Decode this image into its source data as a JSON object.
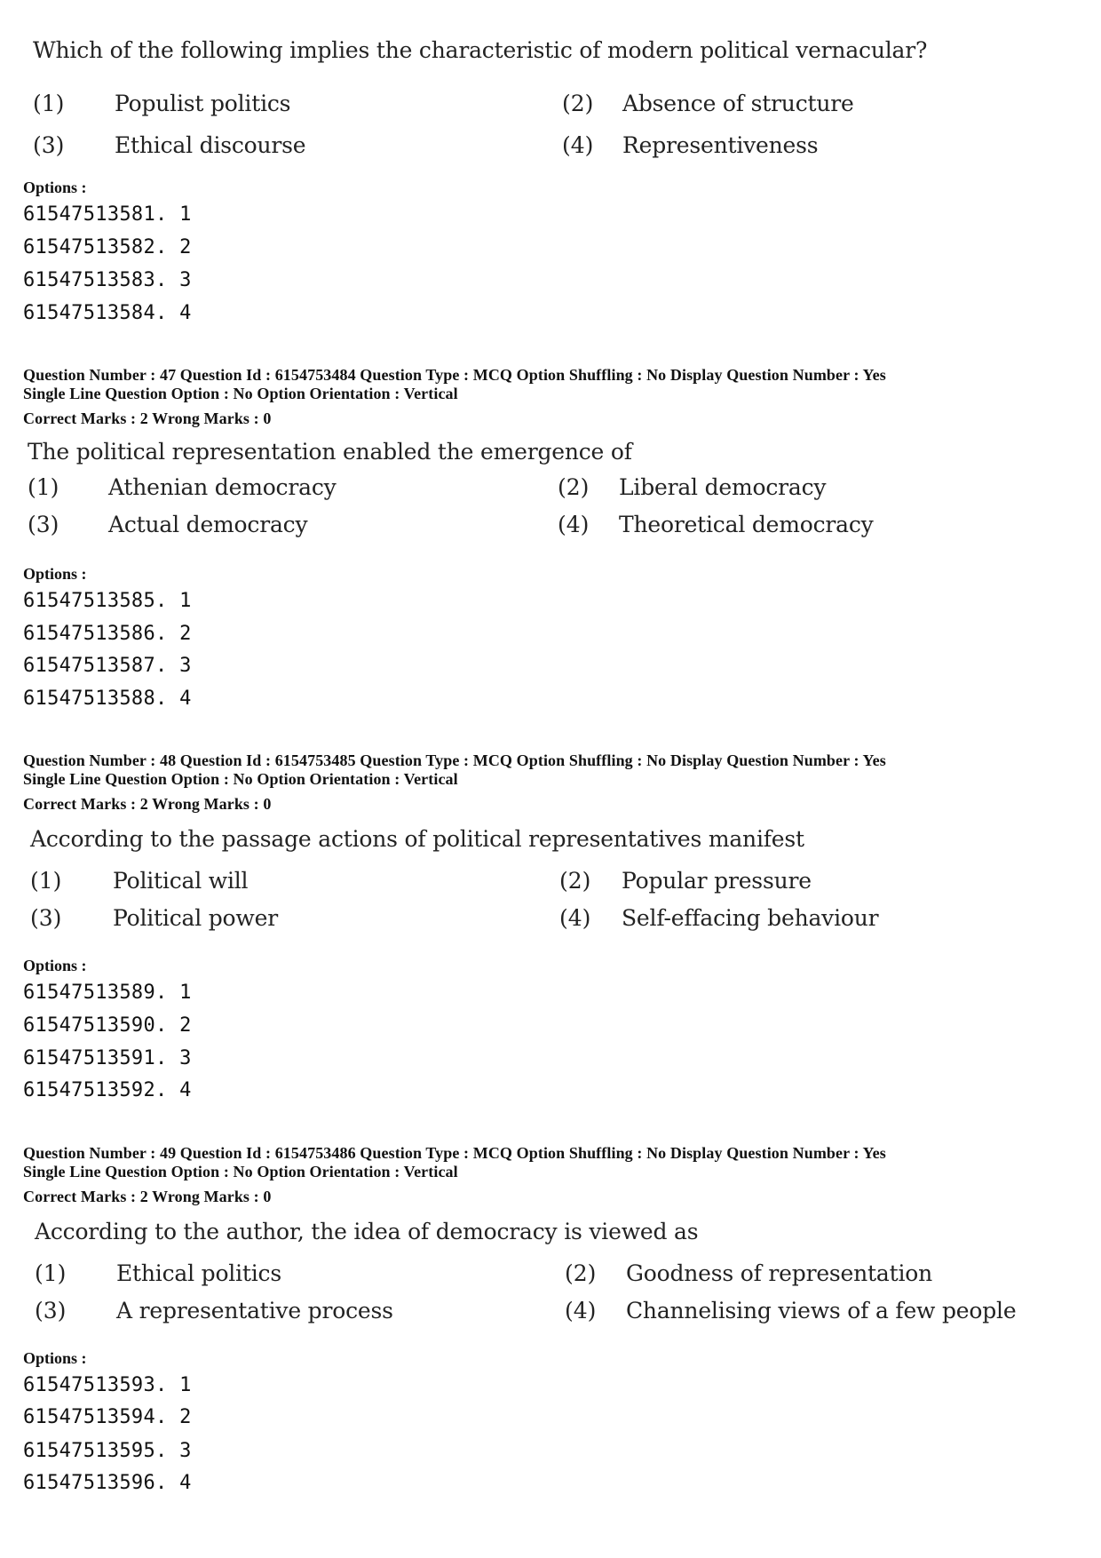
{
  "questions": [
    {
      "header": null,
      "text": "Which of the following implies the characteristic of modern political vernacular?",
      "choices": [
        {
          "num": "(1)",
          "text": "Populist politics"
        },
        {
          "num": "(2)",
          "text": "Absence of structure"
        },
        {
          "num": "(3)",
          "text": "Ethical discourse"
        },
        {
          "num": "(4)",
          "text": "Representiveness"
        }
      ],
      "options_label": "Options :",
      "option_ids": [
        "61547513581. 1",
        "61547513582. 2",
        "61547513583. 3",
        "61547513584. 4"
      ]
    },
    {
      "header": {
        "line1": "Question Number : 47  Question Id : 6154753484  Question Type : MCQ  Option Shuffling : No  Display Question Number : Yes",
        "line2": "Single Line Question Option : No  Option Orientation : Vertical",
        "marks": "Correct Marks : 2  Wrong Marks : 0"
      },
      "text": "The political representation enabled the emergence of",
      "choices": [
        {
          "num": "(1)",
          "text": "Athenian democracy"
        },
        {
          "num": "(2)",
          "text": "Liberal democracy"
        },
        {
          "num": "(3)",
          "text": "Actual democracy"
        },
        {
          "num": "(4)",
          "text": "Theoretical democracy"
        }
      ],
      "options_label": "Options :",
      "option_ids": [
        "61547513585. 1",
        "61547513586. 2",
        "61547513587. 3",
        "61547513588. 4"
      ]
    },
    {
      "header": {
        "line1": "Question Number : 48  Question Id : 6154753485  Question Type : MCQ  Option Shuffling : No  Display Question Number : Yes",
        "line2": "Single Line Question Option : No  Option Orientation : Vertical",
        "marks": "Correct Marks : 2  Wrong Marks : 0"
      },
      "text": "According to the passage actions of political representatives manifest",
      "choices": [
        {
          "num": "(1)",
          "text": "Political will"
        },
        {
          "num": "(2)",
          "text": "Popular pressure"
        },
        {
          "num": "(3)",
          "text": "Political power"
        },
        {
          "num": "(4)",
          "text": "Self-effacing behaviour"
        }
      ],
      "options_label": "Options :",
      "option_ids": [
        "61547513589. 1",
        "61547513590. 2",
        "61547513591. 3",
        "61547513592. 4"
      ]
    },
    {
      "header": {
        "line1": "Question Number : 49  Question Id : 6154753486  Question Type : MCQ  Option Shuffling : No  Display Question Number : Yes",
        "line2": "Single Line Question Option : No  Option Orientation : Vertical",
        "marks": "Correct Marks : 2  Wrong Marks : 0"
      },
      "text": "According to the author, the idea of democracy is viewed as",
      "choices": [
        {
          "num": "(1)",
          "text": "Ethical politics"
        },
        {
          "num": "(2)",
          "text": "Goodness of representation"
        },
        {
          "num": "(3)",
          "text": "A representative process"
        },
        {
          "num": "(4)",
          "text": "Channelising views of a few people"
        }
      ],
      "options_label": "Options :",
      "option_ids": [
        "61547513593. 1",
        "61547513594. 2",
        "61547513595. 3",
        "61547513596. 4"
      ]
    }
  ]
}
